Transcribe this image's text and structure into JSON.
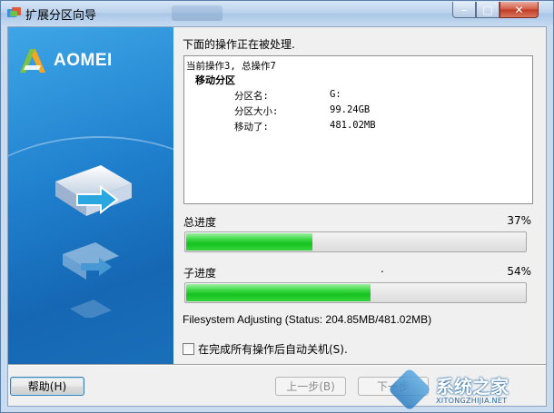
{
  "window": {
    "title": "扩展分区向导",
    "controls": {
      "minimize": "–",
      "maximize": "□",
      "close": "✕"
    }
  },
  "brand": {
    "logo_text": "AOMEI"
  },
  "pane": {
    "title": "下面的操作正在被处理.",
    "log": {
      "current": "当前操作3, 总操作7",
      "operation": "移动分区",
      "rows": [
        {
          "label": "分区名:",
          "value": "G:"
        },
        {
          "label": "分区大小:",
          "value": "99.24GB"
        },
        {
          "label": "移动了:",
          "value": "481.02MB"
        }
      ]
    },
    "total_progress": {
      "label": "总进度",
      "percent_text": "37%",
      "value": 0.37
    },
    "sub_progress": {
      "label": "子进度",
      "percent_text": "54%",
      "value": 0.54,
      "marker": "."
    },
    "status": "Filesystem Adjusting (Status: 204.85MB/481.02MB)",
    "shutdown_option": {
      "label": "在完成所有操作后自动关机(S).",
      "checked": false
    }
  },
  "buttons": {
    "help": "帮助(H)",
    "prev": "上一步(B)",
    "next": "下一步"
  },
  "watermark": {
    "title": "系统之家",
    "url": "XITONGZHIJIA.NET"
  },
  "colors": {
    "progress_fill": "#1ec828",
    "brand_panel": "#1f7fcd"
  },
  "icons": [
    "aomei-app-icon",
    "aomei-logo-icon",
    "disk-move-icon"
  ]
}
